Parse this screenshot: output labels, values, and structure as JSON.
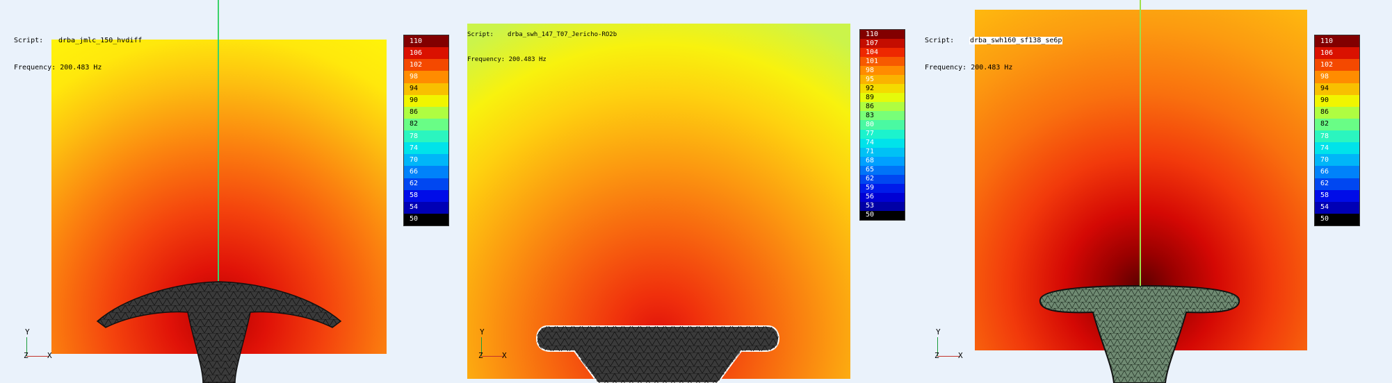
{
  "info_labels": {
    "script": "Script:",
    "frequency": "Frequency:"
  },
  "panels": [
    {
      "script": "drba_jmlc_150_hvdiff",
      "frequency": "200.483 Hz",
      "legend_ticks": [
        "110",
        "106",
        "102",
        "98",
        "94",
        "90",
        "86",
        "82",
        "78",
        "74",
        "70",
        "66",
        "62",
        "58",
        "54",
        "50"
      ]
    },
    {
      "script": "drba_swh_147_T07_Jericho-RO2b",
      "frequency": "200.483 Hz",
      "legend_ticks": [
        "110",
        "107",
        "104",
        "101",
        "98",
        "95",
        "92",
        "89",
        "86",
        "83",
        "80",
        "77",
        "74",
        "71",
        "68",
        "65",
        "62",
        "59",
        "56",
        "53",
        "50"
      ]
    },
    {
      "script": "drba_swh160_sf138_se6p",
      "frequency": "200.483 Hz",
      "legend_ticks": [
        "110",
        "106",
        "102",
        "98",
        "94",
        "90",
        "86",
        "82",
        "78",
        "74",
        "70",
        "66",
        "62",
        "58",
        "54",
        "50"
      ]
    }
  ],
  "axis_labels": {
    "y": "Y",
    "z": "Z",
    "x": "X"
  },
  "colors": {
    "background": "#eaf2fb",
    "axis_line": "#3ad36a",
    "mesh": "#3a3a3a",
    "mesh_green": "#6f8a72"
  }
}
